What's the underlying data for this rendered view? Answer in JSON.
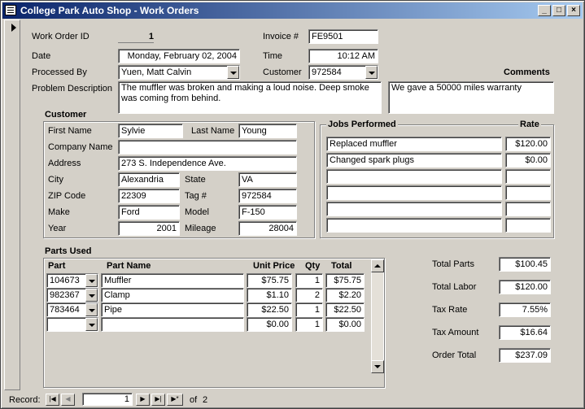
{
  "window": {
    "title": "College Park Auto Shop - Work Orders"
  },
  "order": {
    "id_label": "Work Order ID",
    "id": "1",
    "invoice_label": "Invoice #",
    "invoice": "FE9501",
    "date_label": "Date",
    "date": "Monday, February 02, 2004",
    "time_label": "Time",
    "time": "10:12 AM",
    "processed_label": "Processed By",
    "processed_by": "Yuen, Matt Calvin",
    "customer_label": "Customer",
    "customer_id": "972584",
    "comments_label": "Comments",
    "problem_label": "Problem Description",
    "problem": "The muffler was broken and making a loud noise. Deep smoke was coming from behind.",
    "comments": "We gave a 50000 miles warranty"
  },
  "customer": {
    "section": "Customer",
    "first_name_label": "First Name",
    "first_name": "Sylvie",
    "last_name_label": "Last Name",
    "last_name": "Young",
    "company_label": "Company Name",
    "company": "",
    "address_label": "Address",
    "address": "273 S. Independence Ave.",
    "city_label": "City",
    "city": "Alexandria",
    "state_label": "State",
    "state": "VA",
    "zip_label": "ZIP Code",
    "zip": "22309",
    "tag_label": "Tag #",
    "tag": "972584",
    "make_label": "Make",
    "make": "Ford",
    "model_label": "Model",
    "model": "F-150",
    "year_label": "Year",
    "year": "2001",
    "mileage_label": "Mileage",
    "mileage": "28004"
  },
  "jobs": {
    "section": "Jobs Performed",
    "rate_header": "Rate",
    "rows": [
      {
        "job": "Replaced muffler",
        "rate": "$120.00"
      },
      {
        "job": "Changed spark plugs",
        "rate": "$0.00"
      },
      {
        "job": "",
        "rate": ""
      },
      {
        "job": "",
        "rate": ""
      },
      {
        "job": "",
        "rate": ""
      },
      {
        "job": "",
        "rate": ""
      }
    ]
  },
  "parts": {
    "section": "Parts Used",
    "headers": {
      "part": "Part",
      "name": "Part Name",
      "unit": "Unit Price",
      "qty": "Qty",
      "total": "Total"
    },
    "rows": [
      {
        "part": "104673",
        "name": "Muffler",
        "unit": "$75.75",
        "qty": "1",
        "total": "$75.75"
      },
      {
        "part": "982367",
        "name": "Clamp",
        "unit": "$1.10",
        "qty": "2",
        "total": "$2.20"
      },
      {
        "part": "783464",
        "name": "Pipe",
        "unit": "$22.50",
        "qty": "1",
        "total": "$22.50"
      },
      {
        "part": "",
        "name": "",
        "unit": "$0.00",
        "qty": "1",
        "total": "$0.00"
      }
    ]
  },
  "totals": {
    "parts_label": "Total Parts",
    "parts": "$100.45",
    "labor_label": "Total Labor",
    "labor": "$120.00",
    "taxrate_label": "Tax Rate",
    "taxrate": "7.55%",
    "taxamt_label": "Tax Amount",
    "taxamt": "$16.64",
    "order_label": "Order Total",
    "order": "$237.09"
  },
  "nav": {
    "record_label": "Record:",
    "current": "1",
    "of_label": "of",
    "count": "2"
  },
  "icons": {
    "first": "first-record-icon",
    "prev": "prev-record-icon",
    "next": "next-record-icon",
    "last": "last-record-icon",
    "new": "new-record-icon"
  }
}
